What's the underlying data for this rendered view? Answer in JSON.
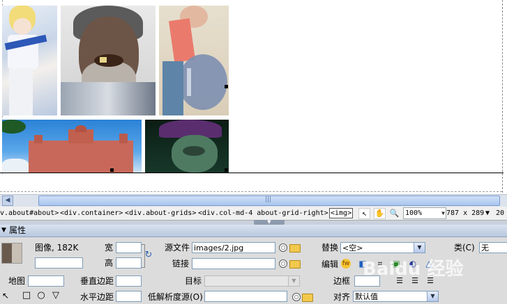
{
  "tag_selector": {
    "tags": [
      "v.about#about>",
      "<div.container>",
      "<div.about-grids>",
      "<div.col-md-4 about-grid-right>",
      "<img>"
    ],
    "zoom": "100%",
    "dimensions": "787 x 289",
    "trailing": "20"
  },
  "panel": {
    "title": "属性",
    "image_label": "图像, 182K",
    "width_label": "宽",
    "height_label": "高",
    "src_label": "源文件",
    "src_value": "images/2.jpg",
    "link_label": "链接",
    "replace_label": "替换",
    "replace_value": "<空>",
    "class_label": "类(C)",
    "class_value": "无",
    "edit_label": "编辑",
    "map_label": "地图",
    "vspace_label": "垂直边距",
    "target_label": "目标",
    "border_label": "边框",
    "hspace_label": "水平边距",
    "lowsrc_label": "低解析度源(O)",
    "align_label": "对齐",
    "align_value": "默认值"
  },
  "watermark": "Baidu 经验",
  "colors": {
    "header": "#c8d6ea",
    "panel": "#dcdcdc",
    "scroll_thumb": "#a9c6ee"
  }
}
